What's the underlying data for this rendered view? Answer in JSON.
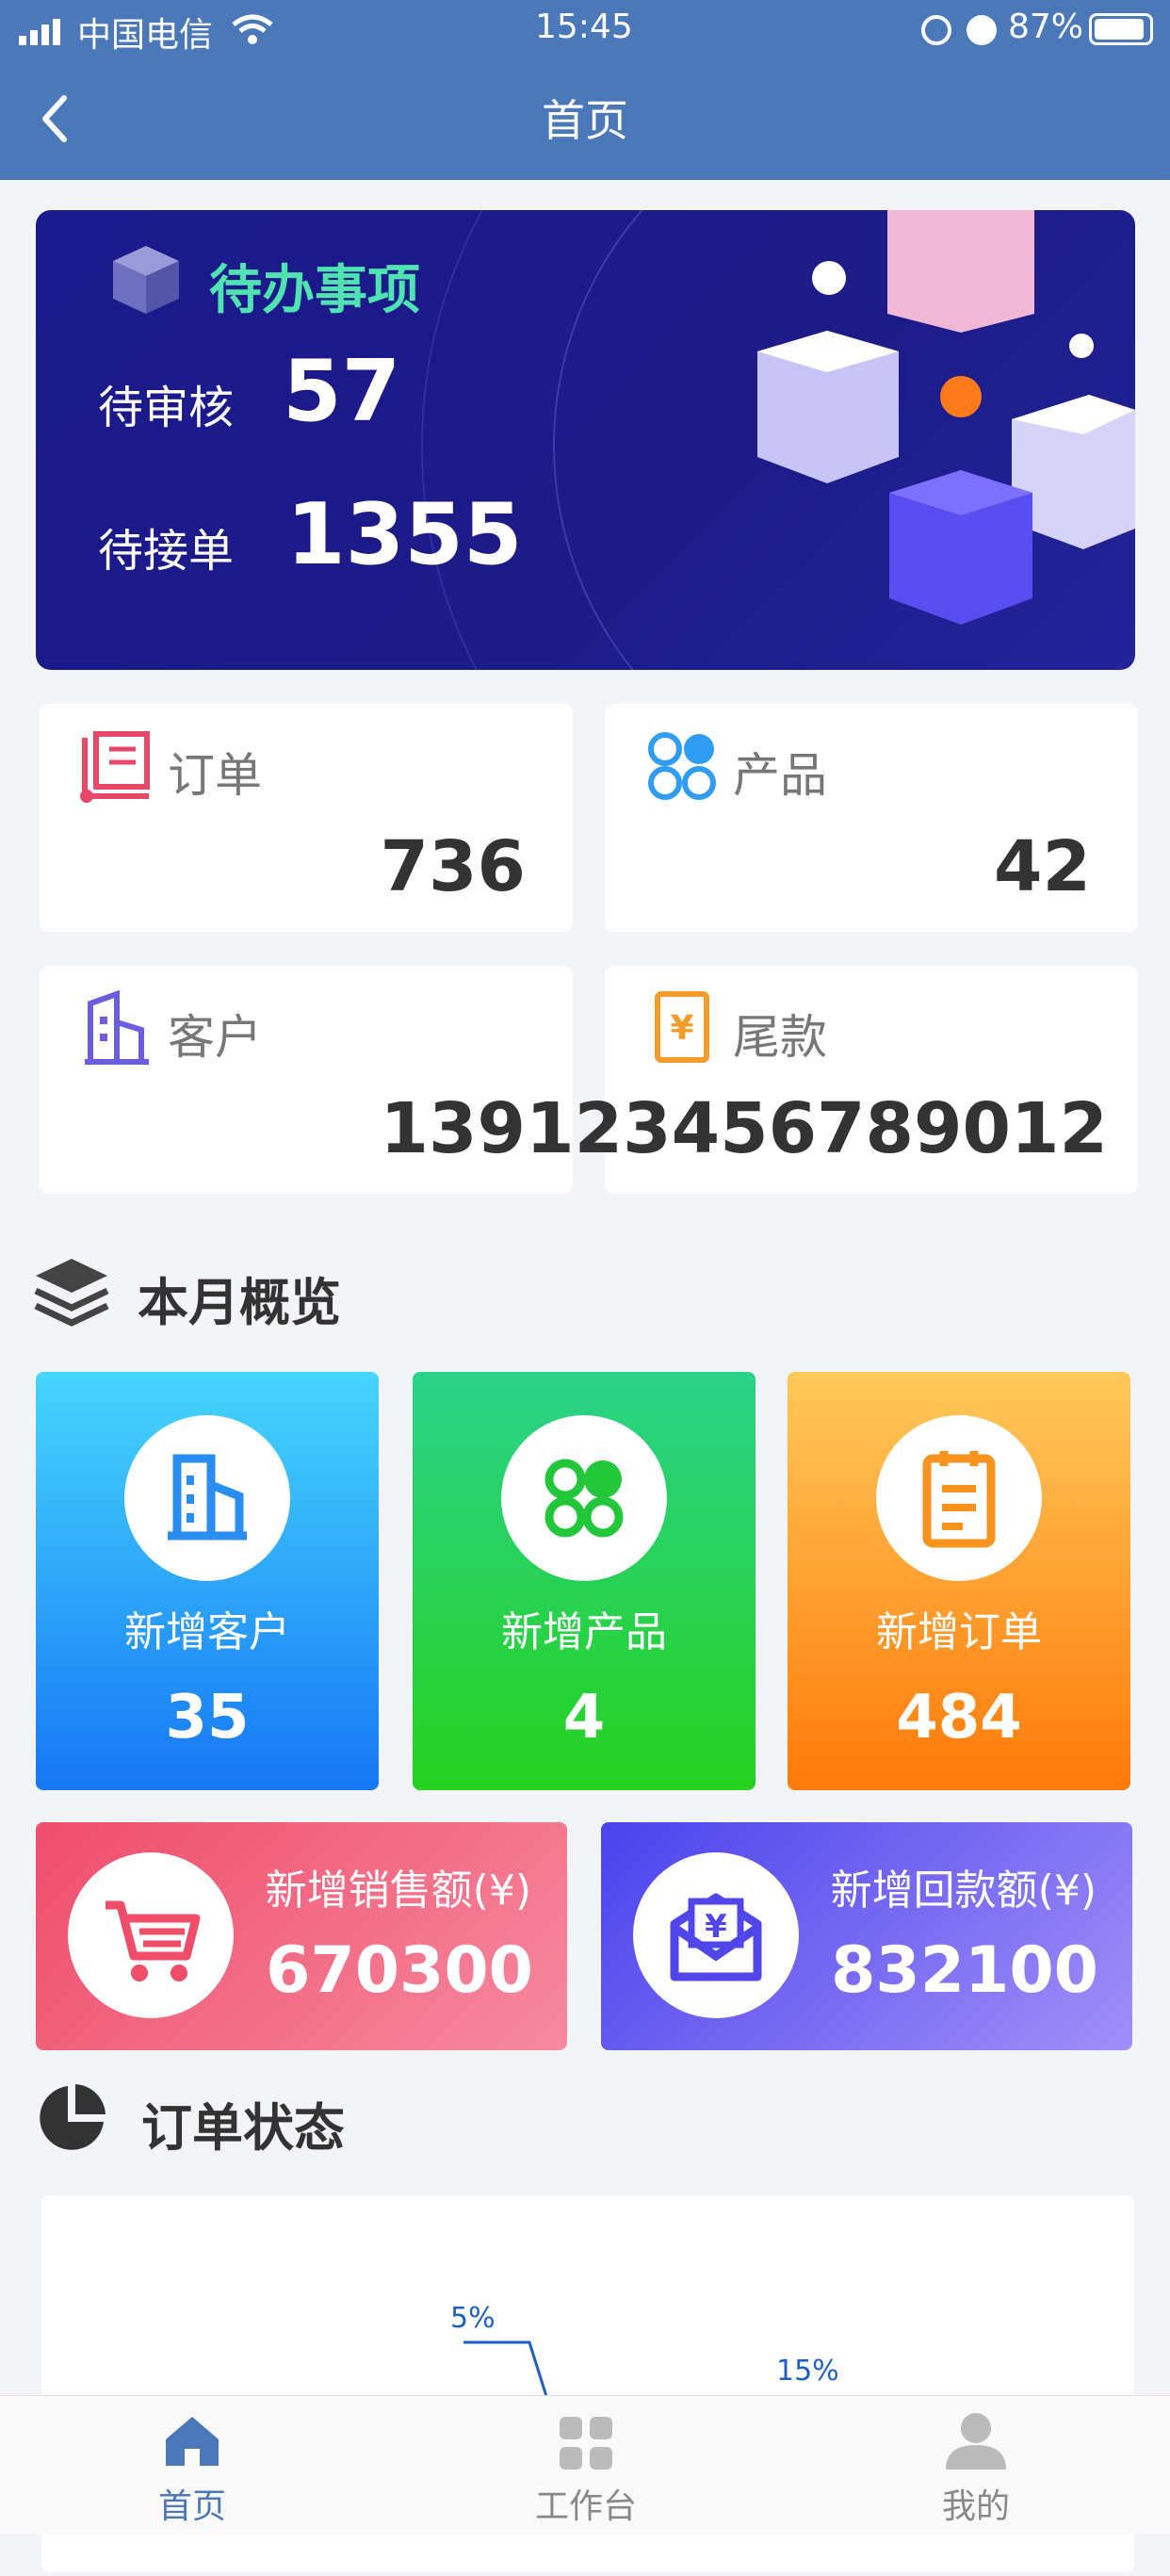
{
  "status_bar": {
    "carrier": "中国电信",
    "time": "15:45",
    "battery": "87%"
  },
  "nav": {
    "title": "首页"
  },
  "todo": {
    "title": "待办事项",
    "items": [
      {
        "label": "待审核",
        "value": "57"
      },
      {
        "label": "待接单",
        "value": "1355"
      }
    ]
  },
  "stats": [
    {
      "label": "订单",
      "value": "736",
      "icon": "order-icon",
      "color": "#e8496a"
    },
    {
      "label": "产品",
      "value": "42",
      "icon": "product-icon",
      "color": "#2f9df4"
    },
    {
      "label": "客户",
      "value": "139",
      "icon": "customer-icon",
      "color": "#6a5de0"
    },
    {
      "label": "尾款",
      "value": "123456789012",
      "icon": "payment-icon",
      "color": "#f59b2a"
    }
  ],
  "overview": {
    "title": "本月概览",
    "tiles": [
      {
        "label": "新增客户",
        "value": "35",
        "icon": "building-icon"
      },
      {
        "label": "新增产品",
        "value": "4",
        "icon": "apps-icon"
      },
      {
        "label": "新增订单",
        "value": "484",
        "icon": "clipboard-icon"
      }
    ],
    "wide": [
      {
        "label": "新增销售额(¥)",
        "value": "670300",
        "icon": "cart-icon"
      },
      {
        "label": "新增回款额(¥)",
        "value": "832100",
        "icon": "mail-money-icon"
      }
    ]
  },
  "order_status": {
    "title": "订单状态"
  },
  "chart_data": {
    "type": "pie",
    "labels_visible": [
      "5%",
      "15%"
    ],
    "values": [
      5,
      15
    ]
  },
  "tabbar": {
    "items": [
      {
        "label": "首页",
        "active": true
      },
      {
        "label": "工作台",
        "active": false
      },
      {
        "label": "我的",
        "active": false
      }
    ]
  },
  "colors": {
    "nav": "#4a78b8",
    "hero": "#1c1b88",
    "accent": "#4a78b8"
  }
}
